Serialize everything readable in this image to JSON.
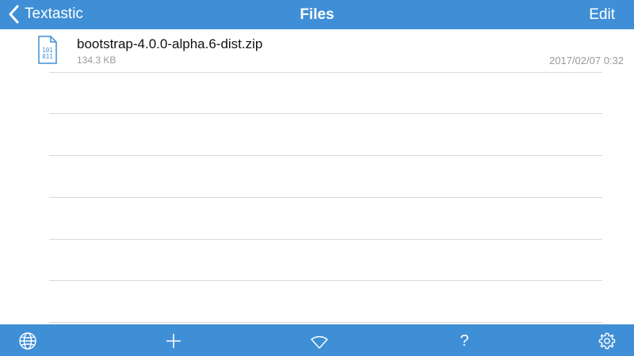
{
  "header": {
    "back_label": "Textastic",
    "title": "Files",
    "edit_label": "Edit"
  },
  "files": [
    {
      "name": "bootstrap-4.0.0-alpha.6-dist.zip",
      "size": "134.3 KB",
      "date": "2017/02/07 0:32",
      "icon": "binary-file-icon",
      "icon_text_top": "101",
      "icon_text_bottom": "011"
    }
  ],
  "toolbar": {
    "items": [
      "globe-icon",
      "plus-icon",
      "wifi-icon",
      "help-icon",
      "gear-icon"
    ],
    "help_glyph": "?"
  },
  "colors": {
    "accent": "#3f8fd6",
    "separator": "#d9d9d9",
    "secondary_text": "#9a9a9a"
  }
}
